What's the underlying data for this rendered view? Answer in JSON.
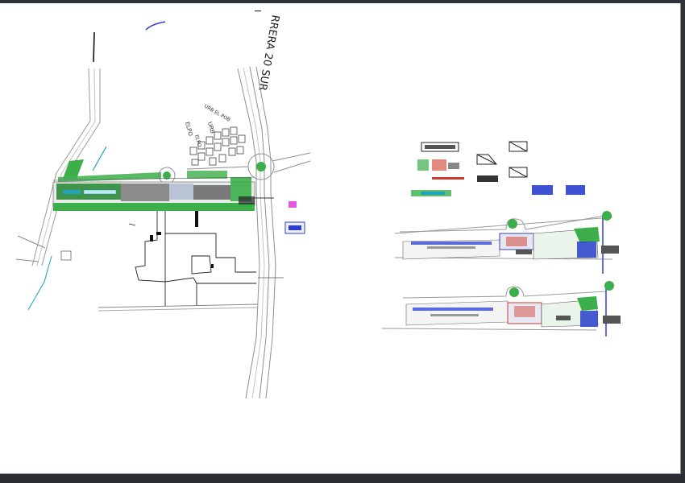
{
  "drawing": {
    "street_label": "RRERA 20 SUR",
    "street_label_mark": "I",
    "urb_label_1": "URB EL POB",
    "urb_label_2": "ELPO",
    "urb_label_3": "URB",
    "urb_label_4": "ELPO"
  },
  "colors": {
    "background": "#ffffff",
    "frame": "#2f3236",
    "road": "#a6a6a6",
    "green": "#3cae4a",
    "dark_green": "#1f6b2a",
    "water": "#1fa3b8",
    "magenta": "#d42fd4",
    "blue": "#2a3fcc",
    "red": "#d23a2a"
  }
}
